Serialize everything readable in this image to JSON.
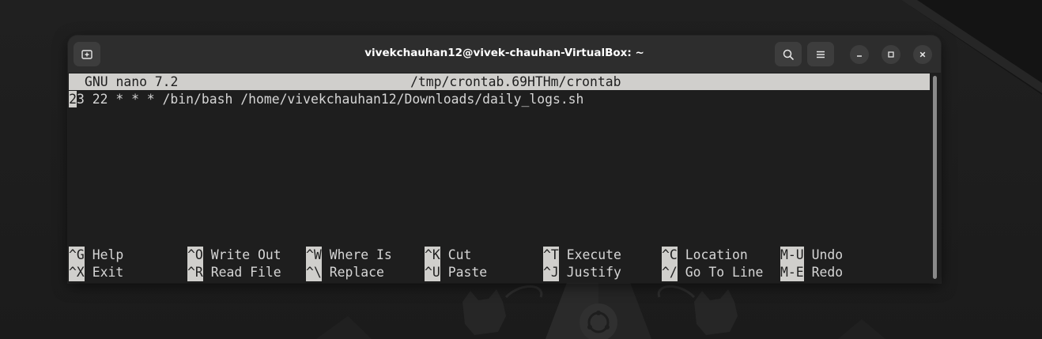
{
  "window": {
    "title": "vivekchauhan12@vivek-chauhan-VirtualBox: ~"
  },
  "headerbar": {
    "new_tab_icon": "new-tab-icon",
    "search_icon": "search-icon",
    "menu_icon": "hamburger-menu-icon",
    "minimize_icon": "minimize-icon",
    "maximize_icon": "maximize-icon",
    "close_icon": "close-icon"
  },
  "nano": {
    "version": "GNU nano 7.2",
    "filename": "/tmp/crontab.69HTHm/crontab",
    "lines": [
      {
        "cursor_char": "2",
        "rest": "3 22 * * * /bin/bash /home/vivekchauhan12/Downloads/daily_logs.sh"
      }
    ],
    "shortcuts": [
      {
        "key": "^G",
        "label": "Help"
      },
      {
        "key": "^O",
        "label": "Write Out"
      },
      {
        "key": "^W",
        "label": "Where Is"
      },
      {
        "key": "^K",
        "label": "Cut"
      },
      {
        "key": "^T",
        "label": "Execute"
      },
      {
        "key": "^C",
        "label": "Location"
      },
      {
        "key": "M-U",
        "label": "Undo"
      },
      {
        "key": "^X",
        "label": "Exit"
      },
      {
        "key": "^R",
        "label": "Read File"
      },
      {
        "key": "^\\",
        "label": "Replace"
      },
      {
        "key": "^U",
        "label": "Paste"
      },
      {
        "key": "^J",
        "label": "Justify"
      },
      {
        "key": "^/",
        "label": "Go To Line"
      },
      {
        "key": "M-E",
        "label": "Redo"
      }
    ]
  },
  "colors": {
    "terminal_bg": "#1e1e1e",
    "headerbar_bg": "#2d2d2d",
    "nano_bar": "#d0cfcc",
    "text": "#d6d6d6"
  }
}
